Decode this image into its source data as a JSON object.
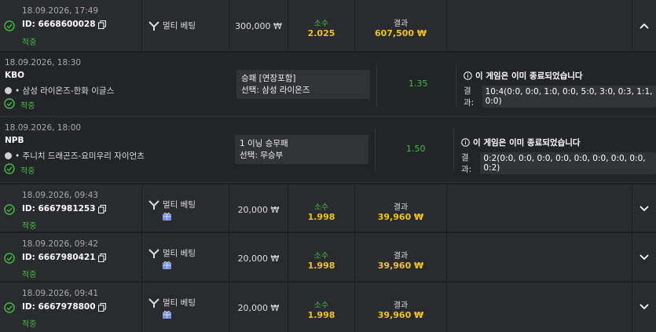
{
  "colors": {
    "status_green": "#3fbf3f",
    "odds_yellow": "#f0c419",
    "row_bg": "#2a2b2e",
    "sub_bg": "#232427"
  },
  "bets": [
    {
      "date": "18.09.2026, 17:49",
      "id": "ID: 6668600028",
      "status": "적중",
      "bet_type": "멀티 베팅",
      "amount": "300,000 ₩",
      "odds_label": "소수",
      "odds": "2.025",
      "result_label": "결과",
      "payout": "607,500 ₩",
      "expanded": true,
      "chevron": "chevron-up-icon",
      "selections": [
        {
          "date": "18.09.2026, 18:30",
          "league": "KBO",
          "match": "• 삼성 라이온즈-한화 이글스",
          "status": "적중",
          "market": "승패 [연장포함]",
          "pick": "선택: 삼성 라이온즈",
          "odds": "1.35",
          "notice": "이 게임은 이미 종료되었습니다",
          "result_label": "결과:",
          "score": "10:4(0:0, 0:0, 1:0, 0:0, 5:0, 3:0, 0:3, 1:1, 0:0)"
        },
        {
          "date": "18.09.2026, 18:00",
          "league": "NPB",
          "match": "• 주니치 드래곤즈-요미우리 자이언츠",
          "status": "적중",
          "market": "1 이닝 승무패",
          "pick": "선택: 무승부",
          "odds": "1.50",
          "notice": "이 게임은 이미 종료되었습니다",
          "result_label": "결과:",
          "score": "0:2(0:0, 0:0, 0:0, 0:0, 0:0, 0:0, 0:0, 0:0, 0:2)"
        }
      ]
    },
    {
      "date": "18.09.2026, 09:43",
      "id": "ID: 6667981253",
      "status": "적중",
      "bet_type": "멀티 베팅",
      "amount": "20,000 ₩",
      "odds_label": "소수",
      "odds": "1.998",
      "result_label": "결과",
      "payout": "39,960 ₩",
      "expanded": false,
      "chevron": "chevron-down-icon"
    },
    {
      "date": "18.09.2026, 09:42",
      "id": "ID: 6667980421",
      "status": "적중",
      "bet_type": "멀티 베팅",
      "amount": "20,000 ₩",
      "odds_label": "소수",
      "odds": "1.998",
      "result_label": "결과",
      "payout": "39,960 ₩",
      "expanded": false,
      "chevron": "chevron-down-icon"
    },
    {
      "date": "18.09.2026, 09:41",
      "id": "ID: 6667978800",
      "status": "적중",
      "bet_type": "멀티 베팅",
      "amount": "20,000 ₩",
      "odds_label": "소수",
      "odds": "1.998",
      "result_label": "결과",
      "payout": "39,960 ₩",
      "expanded": false,
      "chevron": "chevron-down-icon"
    }
  ]
}
